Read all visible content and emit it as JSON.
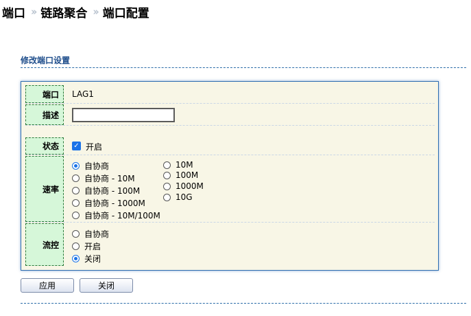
{
  "breadcrumb": {
    "items": [
      "端口",
      "链路聚合",
      "端口配置"
    ],
    "separator": "››"
  },
  "section": {
    "title": "修改端口设置"
  },
  "form": {
    "port": {
      "label": "端口",
      "value": "LAG1"
    },
    "description": {
      "label": "描述",
      "value": ""
    },
    "status": {
      "label": "状态",
      "checkbox_label": "开启",
      "checked": true
    },
    "speed": {
      "label": "速率",
      "options_left": [
        "自协商",
        "自协商 - 10M",
        "自协商 - 100M",
        "自协商 - 1000M",
        "自协商 - 10M/100M"
      ],
      "options_right": [
        "10M",
        "100M",
        "1000M",
        "10G"
      ],
      "selected": "自协商"
    },
    "flow_control": {
      "label": "流控",
      "options": [
        "自协商",
        "开启",
        "关闭"
      ],
      "selected": "关闭"
    }
  },
  "buttons": {
    "apply": "应用",
    "close": "关闭"
  },
  "colors": {
    "accent": "#1a73e8",
    "label_bg": "#d6f7d9",
    "panel_bg": "#f8f6e6",
    "title": "#1f4e8c"
  }
}
